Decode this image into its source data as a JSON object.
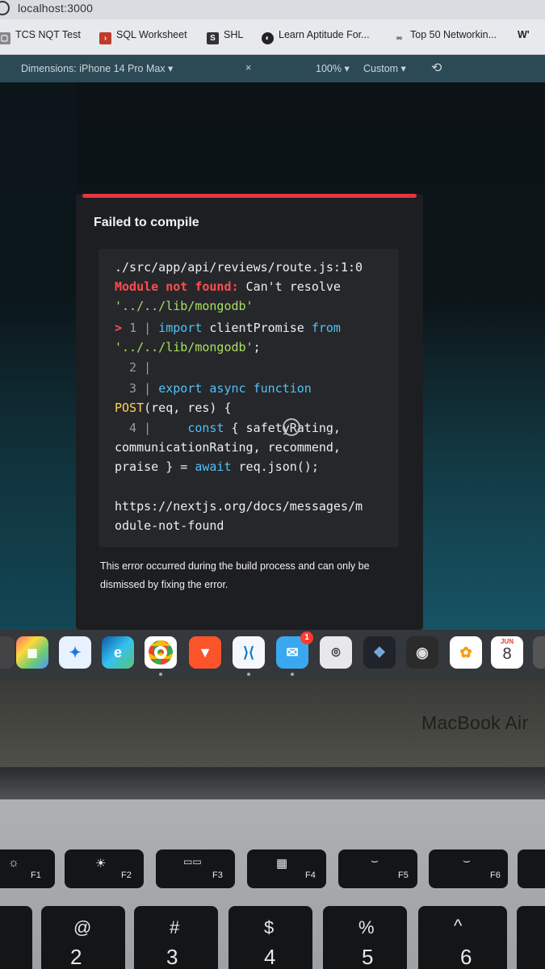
{
  "browser": {
    "url": "localhost:3000",
    "bookmarks": [
      {
        "label": "TCS NQT Test",
        "icon": "box-icon"
      },
      {
        "label": "SQL Worksheet",
        "icon": "sql-icon"
      },
      {
        "label": "SHL",
        "icon": "shl-icon"
      },
      {
        "label": "Learn Aptitude For...",
        "icon": "aptitude-icon"
      },
      {
        "label": "Top 50 Networkin...",
        "icon": "link-icon"
      }
    ]
  },
  "device_toolbar": {
    "dimensions": "Dimensions: iPhone 14 Pro Max ▾",
    "close": "×",
    "zoom": "100% ▾",
    "throttle": "Custom ▾"
  },
  "error_overlay": {
    "title": "Failed to compile",
    "file": "./src/app/api/reviews/route.js:1:0",
    "error_label": "Module not found:",
    "error_message": " Can't resolve",
    "module_path": "'../../lib/mongodb'",
    "line1_marker": "> ",
    "line1_num": "1 | ",
    "line1_kw1": "import ",
    "line1_ident": "clientPromise ",
    "line1_kw2": "from",
    "line1_str": "'../../lib/mongodb'",
    "line1_end": ";",
    "line2": "  2 |",
    "line3_num": "  3 | ",
    "line3_code": "export async function",
    "line3_cont_fn": "POST",
    "line3_cont_rest": "(req, res) {",
    "line4_num": "  4 |     ",
    "line4_kw": "const",
    "line4_rest": " { safetyRating,",
    "line4_cont1": "communicationRating, recommend,",
    "line4_cont2_a": "praise } = ",
    "line4_cont2_kw": "await",
    "line4_cont2_b": " req.json();",
    "doc_link_1": "https://nextjs.org/docs/messages/m",
    "doc_link_2": "odule-not-found",
    "footer": "This error occurred during the build process and can only be dismissed by fixing the error."
  },
  "dock": {
    "mail_badge": "1",
    "calendar_month": "JUN",
    "calendar_day": "8"
  },
  "laptop": {
    "brand": "MacBook Air",
    "fkeys": [
      {
        "label": "F1",
        "glyph": "☼"
      },
      {
        "label": "F2",
        "glyph": "☀"
      },
      {
        "label": "F3",
        "glyph": "▭▭"
      },
      {
        "label": "F4",
        "glyph": "▦"
      },
      {
        "label": "F5",
        "glyph": "⌣"
      },
      {
        "label": "F6",
        "glyph": "⌣"
      }
    ],
    "numkeys": [
      {
        "top": "@",
        "bottom": "2"
      },
      {
        "top": "#",
        "bottom": "3"
      },
      {
        "top": "$",
        "bottom": "4"
      },
      {
        "top": "%",
        "bottom": "5"
      },
      {
        "top": "^",
        "bottom": "6"
      }
    ]
  }
}
